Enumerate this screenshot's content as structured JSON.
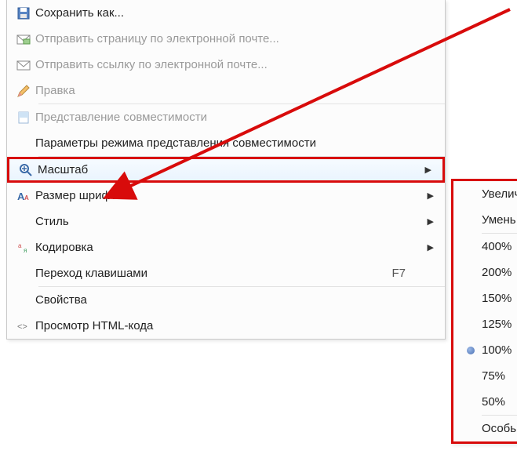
{
  "menu": {
    "save_as": "Сохранить как...",
    "send_page_email": "Отправить страницу по электронной почте...",
    "send_link_email": "Отправить ссылку по электронной почте...",
    "edit": "Правка",
    "compat_view": "Представление совместимости",
    "compat_params": "Параметры режима представления совместимости",
    "zoom": "Масштаб",
    "font_size": "Размер шрифта",
    "style": "Стиль",
    "encoding": "Кодировка",
    "caret_browsing": "Переход клавишами",
    "caret_shortcut": "F7",
    "properties": "Свойства",
    "view_source": "Просмотр HTML-кода"
  },
  "zoom_menu": {
    "zoom_in": "Увелич",
    "zoom_out": "Умень",
    "z400": "400%",
    "z200": "200%",
    "z150": "150%",
    "z125": "125%",
    "z100": "100%",
    "z75": "75%",
    "z50": "50%",
    "custom": "Особь"
  }
}
